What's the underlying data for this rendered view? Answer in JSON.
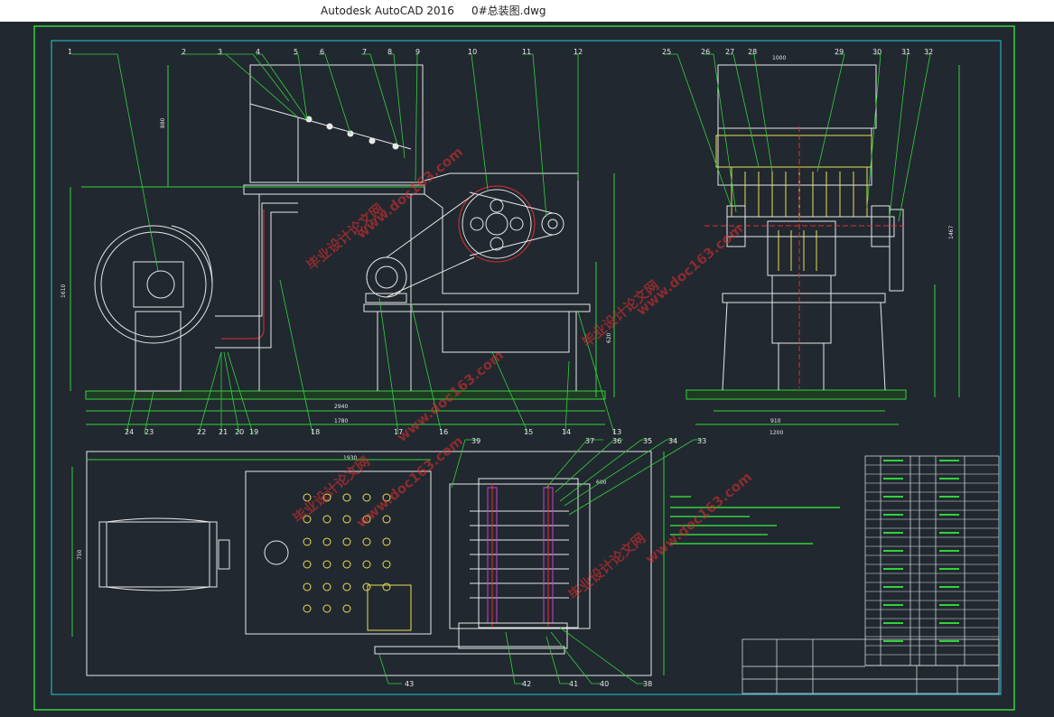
{
  "window": {
    "title": "Autodesk AutoCAD 2016     0#总装图.dwg"
  },
  "drawing": {
    "balloons_front": [
      "1",
      "2",
      "3",
      "4",
      "5",
      "6",
      "7",
      "8",
      "9",
      "10",
      "11",
      "12"
    ],
    "balloons_front_bottom": [
      "24",
      "23",
      "22",
      "21",
      "20",
      "19",
      "18",
      "17",
      "16",
      "15",
      "14",
      "13"
    ],
    "balloons_side": [
      "25",
      "26",
      "27",
      "28",
      "29",
      "30",
      "31",
      "32"
    ],
    "balloons_top": [
      "39",
      "37",
      "36",
      "35",
      "34",
      "33",
      "43",
      "42",
      "41",
      "40",
      "38"
    ],
    "watermark": "www.doc163.com",
    "watermark_cn": "毕业设计论文网",
    "dims": [
      "1780",
      "2940",
      "1610",
      "1467",
      "880",
      "1200",
      "910",
      "620",
      "1000",
      "750",
      "600",
      "1930"
    ]
  },
  "colors": {
    "bg": "#212830",
    "line": "#e8e8e8",
    "green": "#32d23c",
    "cyan": "#28c8e0",
    "red": "#e03030",
    "yellow": "#e8e050",
    "magenta": "#d040d0"
  }
}
